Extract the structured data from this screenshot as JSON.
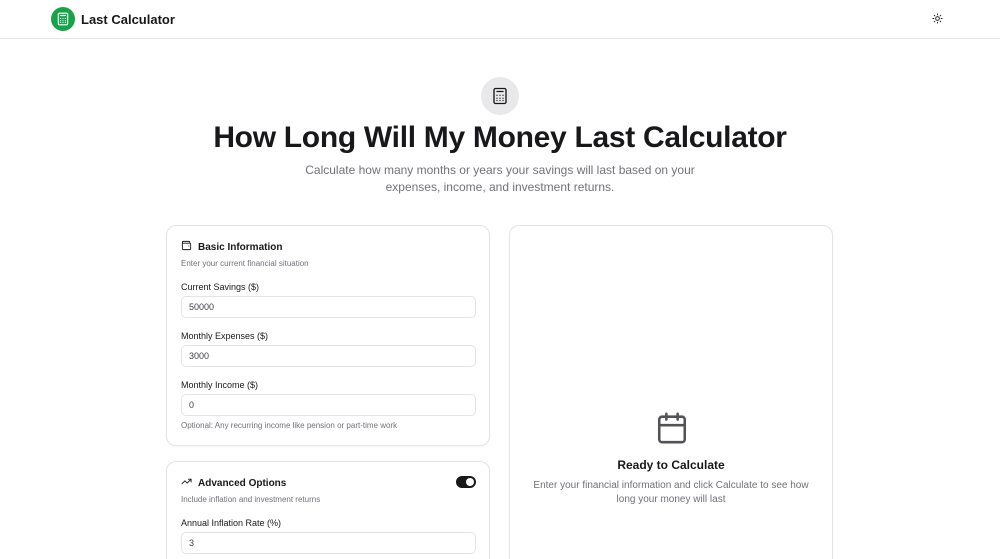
{
  "header": {
    "brand_name": "Last Calculator",
    "logo_icon": "calculator-icon",
    "theme_icon": "sun-icon"
  },
  "hero": {
    "icon": "calculator-icon",
    "title": "How Long Will My Money Last Calculator",
    "subtitle": "Calculate how many months or years your savings will last based on your expenses, income, and investment returns."
  },
  "basic": {
    "icon": "wallet-icon",
    "title": "Basic Information",
    "description": "Enter your current financial situation",
    "fields": [
      {
        "label": "Current Savings ($)",
        "value": "50000"
      },
      {
        "label": "Monthly Expenses ($)",
        "value": "3000"
      },
      {
        "label": "Monthly Income ($)",
        "value": "0"
      }
    ],
    "income_hint": "Optional: Any recurring income like pension or part-time work"
  },
  "advanced": {
    "icon": "trending-up-icon",
    "title": "Advanced Options",
    "description": "Include inflation and investment returns",
    "enabled": true,
    "fields": [
      {
        "label": "Annual Inflation Rate (%)",
        "value": "3"
      }
    ]
  },
  "result": {
    "icon": "calendar-icon",
    "title": "Ready to Calculate",
    "description": "Enter your financial information and click Calculate to see how long your money will last"
  },
  "colors": {
    "brand": "#16a34a",
    "text": "#18181b",
    "muted": "#71717a",
    "border": "#e4e4e7",
    "toggle_on": "#18181b"
  }
}
